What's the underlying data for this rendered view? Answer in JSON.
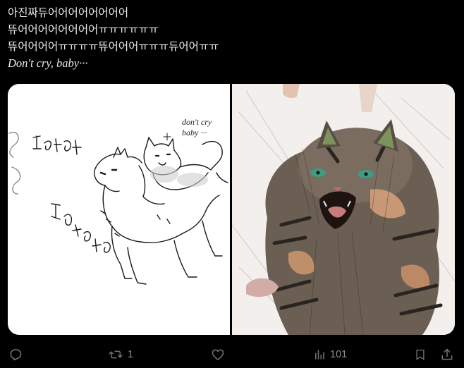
{
  "tweet": {
    "lines": [
      "아진짜듀어어어어어어어어",
      "뜌어어어어어어어어ㅠㅠㅠㅠㅠㅠ",
      "뜌어어어어ㅠㅠㅠㅠ뜌어어어ㅠㅠㅠ듀어어ㅠㅠ",
      "Don't cry, baby···"
    ]
  },
  "media": {
    "left_image": {
      "description_icon": "cartoon-cat-drawing",
      "caption_lines": [
        "don't cry",
        "baby ···"
      ]
    },
    "right_image": {
      "description_icon": "crying-tabby-kitten-drawing"
    }
  },
  "actions": {
    "reply": {
      "icon": "reply-icon",
      "count": ""
    },
    "retweet": {
      "icon": "retweet-icon",
      "count": "1"
    },
    "like": {
      "icon": "heart-icon",
      "count": ""
    },
    "views": {
      "icon": "views-chart-icon",
      "count": "101"
    },
    "bookmark": {
      "icon": "bookmark-icon"
    },
    "share": {
      "icon": "share-icon"
    }
  },
  "colors": {
    "background": "#000000",
    "text": "#e7e9ea",
    "action_gray": "#71767b"
  }
}
